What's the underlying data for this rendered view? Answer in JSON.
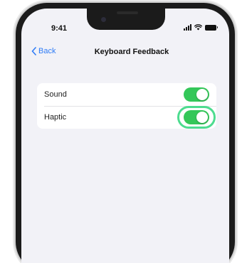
{
  "status_bar": {
    "time": "9:41",
    "icons": [
      "signal-icon",
      "wifi-icon",
      "battery-icon"
    ]
  },
  "nav": {
    "back_label": "Back",
    "title": "Keyboard Feedback"
  },
  "settings": [
    {
      "label": "Sound",
      "toggle_on": true,
      "highlighted": false
    },
    {
      "label": "Haptic",
      "toggle_on": true,
      "highlighted": true
    }
  ],
  "colors": {
    "accent_blue": "#2f7cf6",
    "toggle_green": "#34c759",
    "highlight_green": "#4ddc8f",
    "background": "#f2f2f7"
  }
}
